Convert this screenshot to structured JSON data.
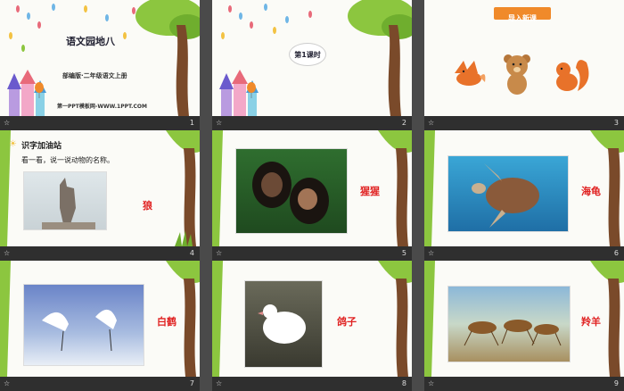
{
  "slides": [
    {
      "number": "1",
      "title": "语文园地八",
      "subtitle": "部编版·二年级语文上册",
      "footer": "第一PPT模板网-WWW.1PPT.COM"
    },
    {
      "number": "2",
      "badge": "第1课时"
    },
    {
      "number": "3",
      "banner": "导入新课"
    },
    {
      "number": "4",
      "heading": "识字加油站",
      "instruction": "看一看，说一说动物的名称。",
      "label": "狼"
    },
    {
      "number": "5",
      "label": "猩猩"
    },
    {
      "number": "6",
      "label": "海龟"
    },
    {
      "number": "7",
      "label": "白鹤"
    },
    {
      "number": "8",
      "label": "鸽子"
    },
    {
      "number": "9",
      "label": "羚羊"
    }
  ],
  "star_glyph": "☆",
  "colors": {
    "accent_red": "#e02020",
    "banner_orange": "#f08a2a",
    "leaf_green": "#8cc63f",
    "trunk_brown": "#7a4a2a"
  }
}
